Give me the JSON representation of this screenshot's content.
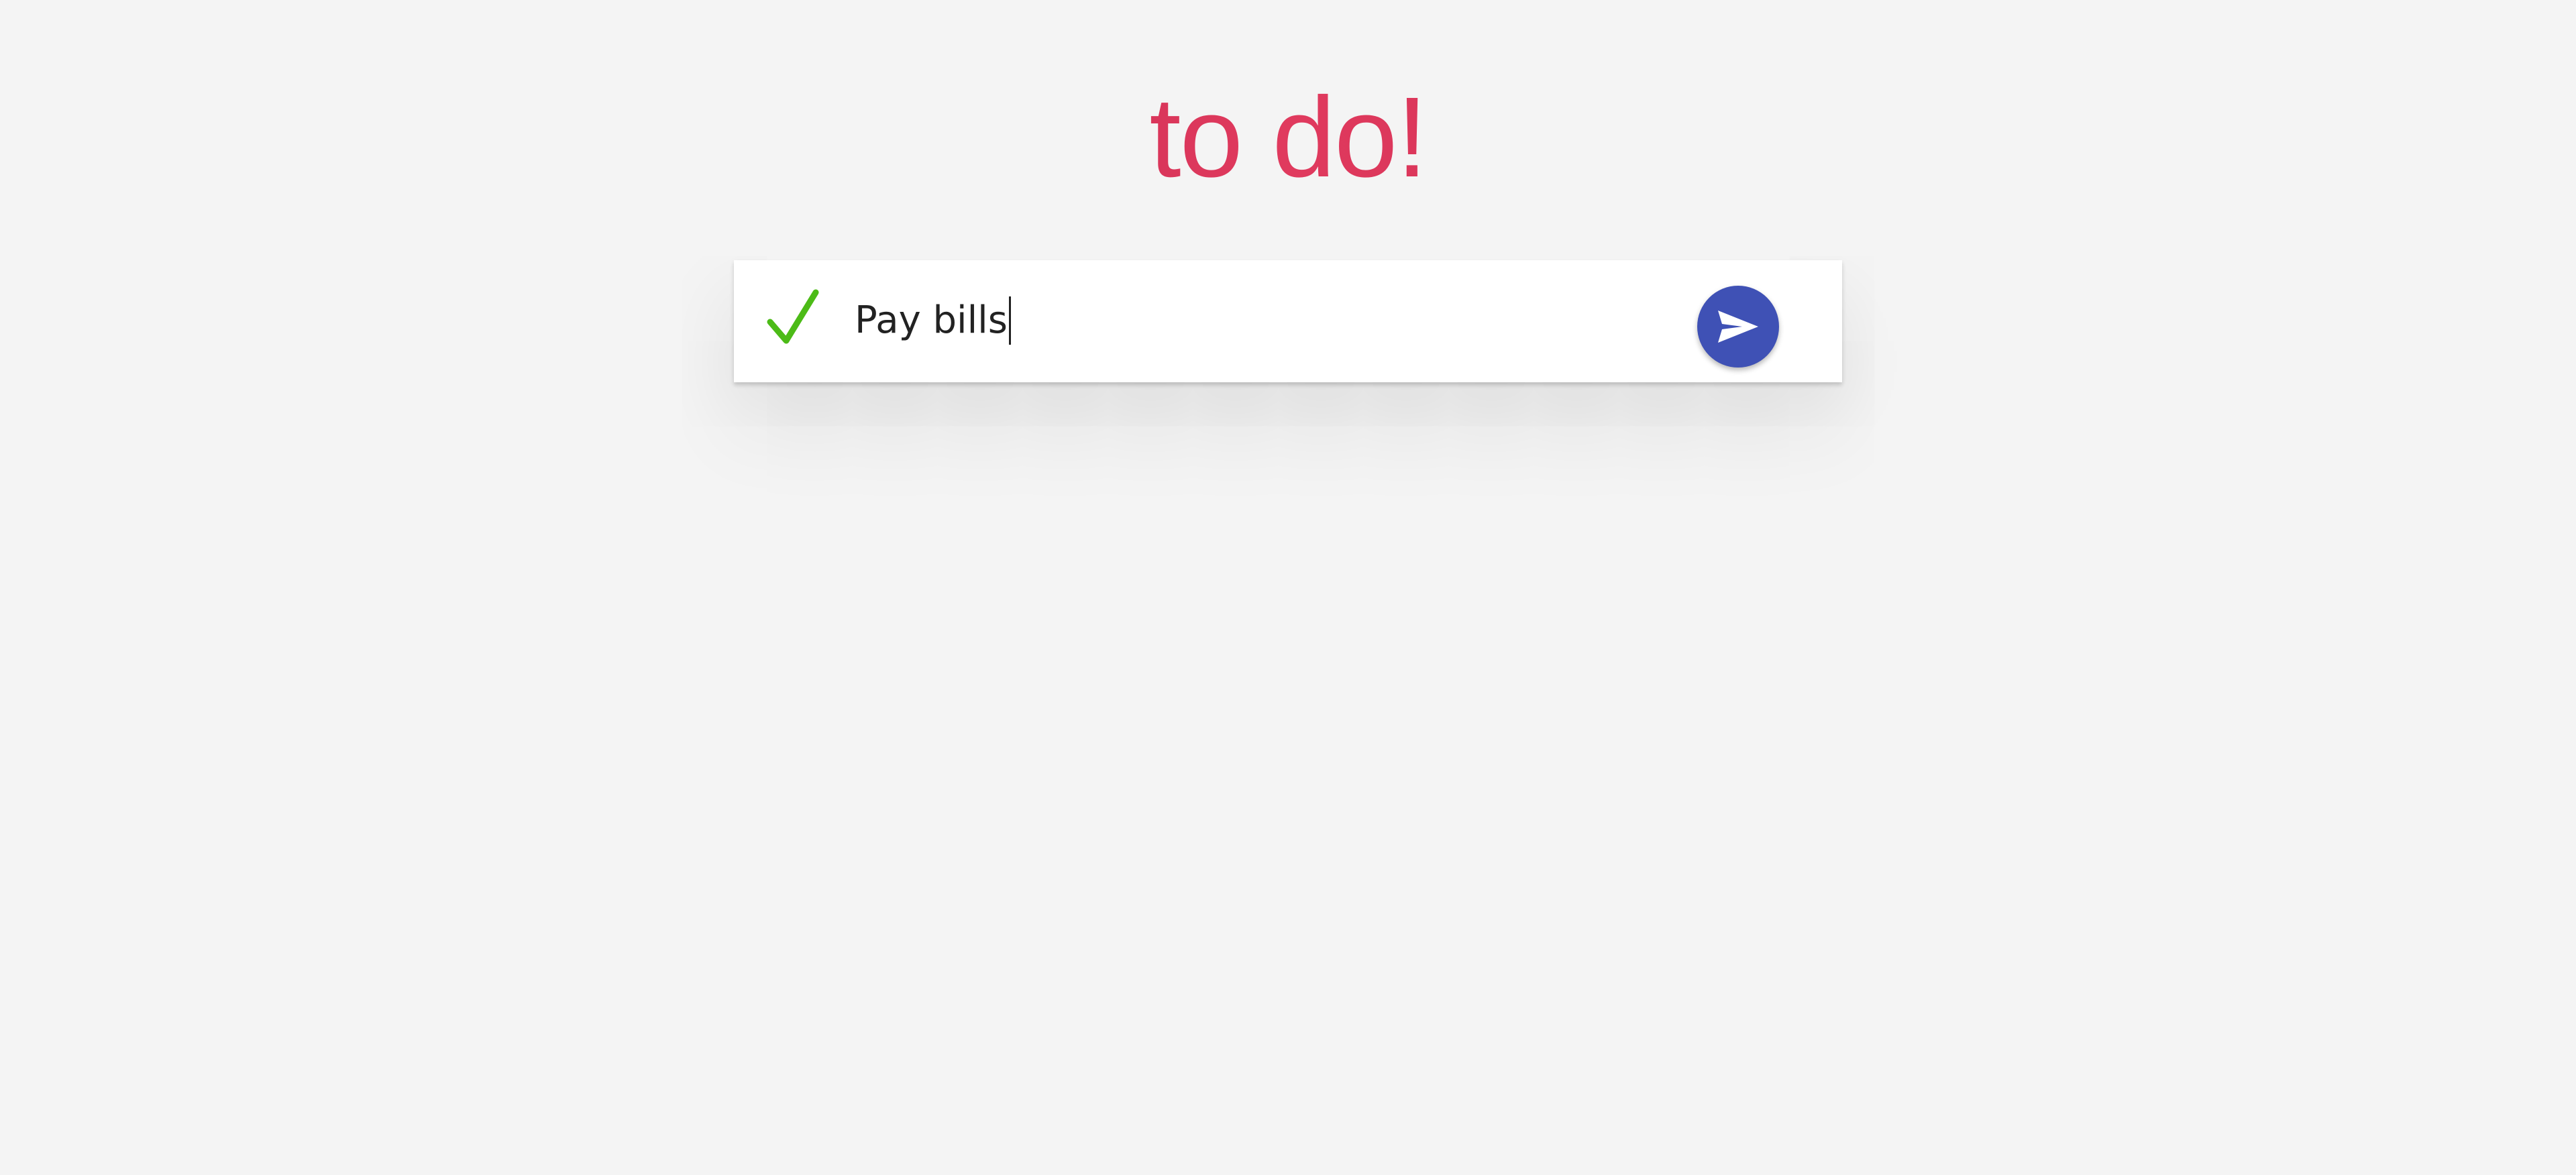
{
  "app": {
    "title": "to do!"
  },
  "todo_input": {
    "value": "Pay bills",
    "placeholder": ""
  },
  "icons": {
    "check": "check-icon",
    "send": "send-icon"
  },
  "colors": {
    "background": "#f4f4f4",
    "title_gradient_start": "#a5163e",
    "title_gradient_mid": "#e03a5e",
    "check": "#4cbb17",
    "send_button": "#3f51b5"
  }
}
